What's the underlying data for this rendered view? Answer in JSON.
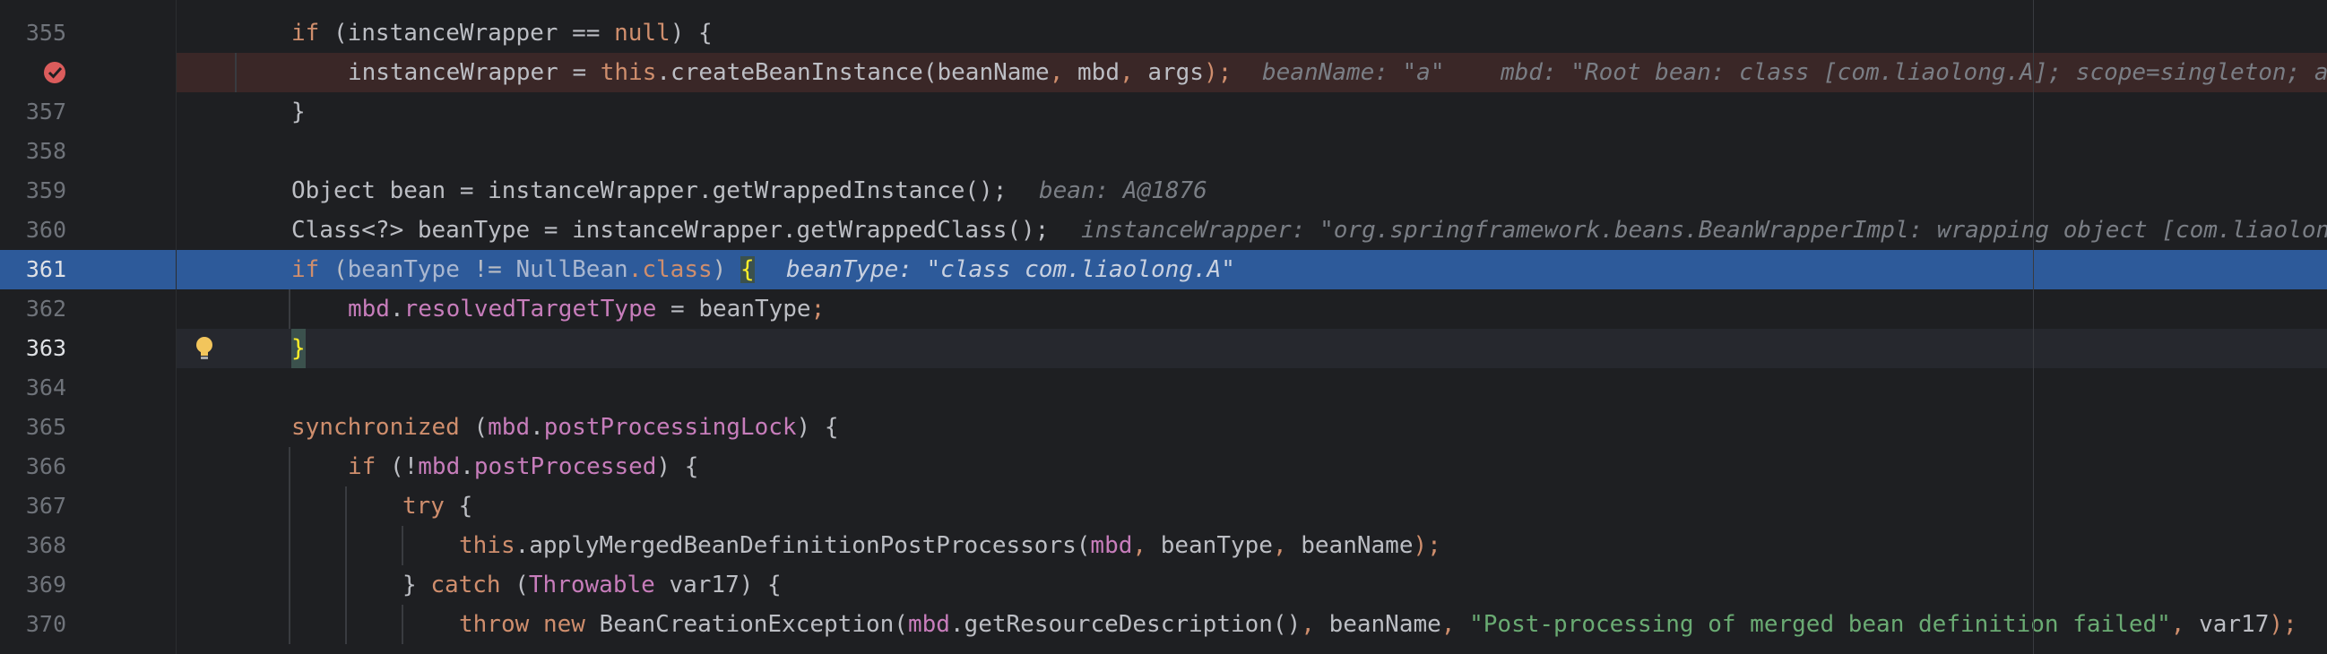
{
  "gutter": {
    "line_numbers": [
      "355",
      "356",
      "357",
      "358",
      "359",
      "360",
      "361",
      "362",
      "363",
      "364",
      "365",
      "366",
      "367",
      "368",
      "369",
      "370"
    ],
    "current_line": "363",
    "breakpoint_line": "356",
    "highlighted_line": "361"
  },
  "code": {
    "l355": {
      "t1": "if",
      "t2": " (",
      "t3": "instanceWrapper",
      "t4": " == ",
      "t5": "null",
      "t6": ") {"
    },
    "l356": {
      "t1": "instanceWrapper",
      "t2": " = ",
      "t3": "this",
      "t4": ".createBeanInstance(",
      "t5": "beanName",
      "t6": ", ",
      "t7": "mbd",
      "t8": ", ",
      "t9": "args",
      "t10": ");",
      "h1": "beanName: \"a\"",
      "h2": "mbd: \"Root bean: class [com.liaolong.A]; scope=singleton; a"
    },
    "l357": {
      "t1": "}"
    },
    "l359": {
      "t1": "Object bean = ",
      "t2": "instanceWrapper",
      ".t3": "",
      "t3": ".getWrappedInstance();",
      "h1": "bean: A@1876"
    },
    "l360": {
      "t1": "Class<?> beanType = ",
      "t2": "instanceWrapper",
      "t3": ".getWrappedClass();",
      "h1": "instanceWrapper: \"org.springframework.beans.BeanWrapperImpl: wrapping object [com.liaolon"
    },
    "l361": {
      "t1": "if",
      "t2": " (",
      "t3": "beanType",
      "t4": " != ",
      "t5": "NullBean",
      ".t6": "",
      "t6": ".class",
      "t7": ") ",
      "t8": "{",
      "h1": "beanType: \"class com.liaolong.A\""
    },
    "l362": {
      "t1": "mbd",
      ".t2": "",
      "t2": ".",
      "t3": "resolvedTargetType",
      "t4": " = ",
      "t5": "beanType",
      "t6": ";"
    },
    "l363": {
      "t1": "}"
    },
    "l365": {
      "t1": "synchronized",
      "t2": " (",
      "t3": "mbd",
      "t4": ".",
      "t5": "postProcessingLock",
      "t6": ") {"
    },
    "l366": {
      "t1": "if",
      "t2": " (!",
      "t3": "mbd",
      "t4": ".",
      "t5": "postProcessed",
      "t6": ") {"
    },
    "l367": {
      "t1": "try",
      "t2": " {"
    },
    "l368": {
      "t1": "this",
      "t2": ".applyMergedBeanDefinitionPostProcessors(",
      "t3": "mbd",
      "t4": ", ",
      "t5": "beanType",
      "t6": ", ",
      "t7": "beanName",
      "t8": ");"
    },
    "l369": {
      "t1": "} ",
      "t2": "catch",
      "t3": " (",
      "t4": "Throwable",
      "t5": " var17) {"
    },
    "l370": {
      "t1": "throw",
      "t2": " ",
      "t3": "new",
      "t4": " BeanCreationException(",
      "t5": "mbd",
      "t6": ".getResourceDescription()",
      "t7": ", ",
      "t8": "beanName",
      "t9": ", ",
      "t10": "\"Post-processing of merged bean definition failed\"",
      "t11": ", ",
      "t12": "var17",
      "t13": ");"
    }
  },
  "icons": {
    "breakpoint": "breakpoint-hit-icon",
    "intention": "lightbulb-icon"
  },
  "colors": {
    "background": "#1e1f22",
    "highlight": "#2d5a9a",
    "keyword": "#cf8e6d",
    "string": "#6aab73",
    "hint": "#7a7e85"
  }
}
